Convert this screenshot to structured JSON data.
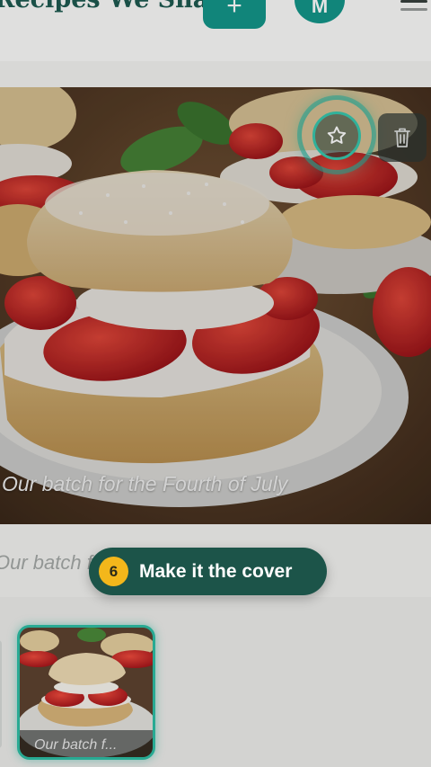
{
  "header": {
    "app_title": "Recipes We Share",
    "add_label": "+",
    "avatar_initial": "M"
  },
  "hero": {
    "caption": "Our batch for the Fourth of July",
    "cover_icon": "star-icon",
    "delete_icon": "trash-icon"
  },
  "caption_field": {
    "value": "Our batch for the Fourth of July"
  },
  "thumbnails": [
    {
      "caption": "Our batch f...",
      "selected": true
    }
  ],
  "tour": {
    "step": "6",
    "message": "Make it the cover"
  },
  "colors": {
    "brand_teal": "#14968a",
    "highlight_teal": "#2dbfa6",
    "tooltip_bg": "#1c5449",
    "step_badge": "#f3b71b"
  }
}
